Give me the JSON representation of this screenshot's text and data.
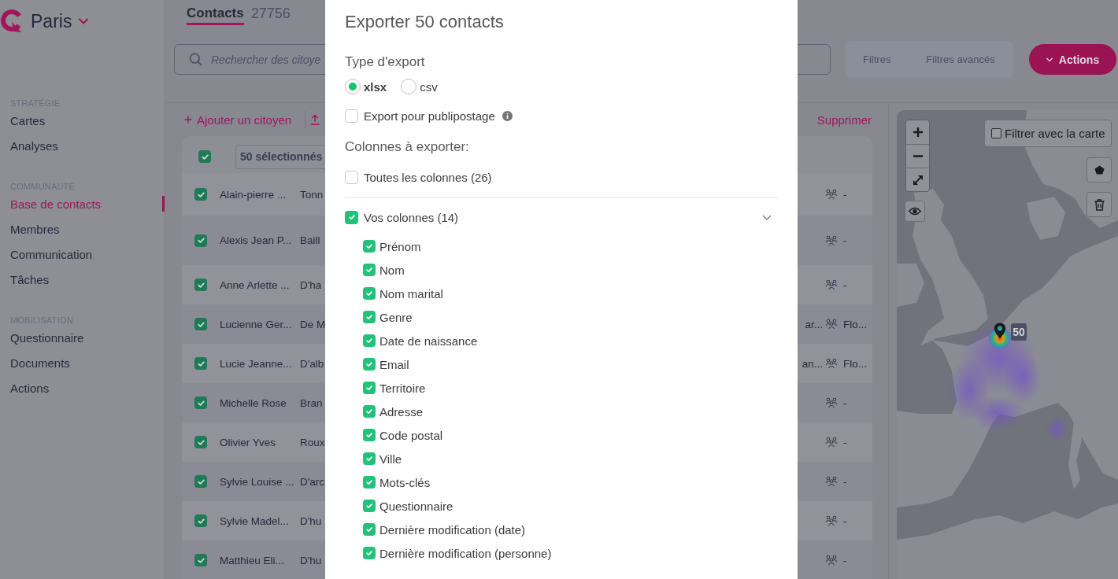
{
  "sidebar": {
    "workspace": "Paris",
    "sections": [
      {
        "heading": "STRATÉGIE",
        "items": [
          {
            "label": "Cartes",
            "selected": false
          },
          {
            "label": "Analyses",
            "selected": false
          }
        ]
      },
      {
        "heading": "COMMUNAUTÉ",
        "items": [
          {
            "label": "Base de contacts",
            "selected": true
          },
          {
            "label": "Membres",
            "selected": false
          },
          {
            "label": "Communication",
            "selected": false
          },
          {
            "label": "Tâches",
            "selected": false
          }
        ]
      },
      {
        "heading": "MOBILISATION",
        "items": [
          {
            "label": "Questionnaire",
            "selected": false
          },
          {
            "label": "Documents",
            "selected": false
          },
          {
            "label": "Actions",
            "selected": false
          }
        ]
      }
    ]
  },
  "tabs": [
    {
      "label": "Contacts",
      "count": "27756",
      "selected": true
    }
  ],
  "search": {
    "placeholder": "Rechercher des citoye"
  },
  "filters": [
    "Filtres",
    "Filtres avancés"
  ],
  "actions_button": {
    "label": "Actions"
  },
  "toolbar": {
    "add_label": "Ajouter un citoyen",
    "delete_label": "Supprimer"
  },
  "table": {
    "select_all": {
      "checked": true
    },
    "selection_label": "50 sélectionnés",
    "rows": [
      {
        "checked": true,
        "column_1": "Alain-pierre ...",
        "column_2": "Tonn",
        "column_4": "-"
      },
      {
        "checked": true,
        "column_1": "Alexis Jean P...",
        "column_2": "Baill",
        "column_4": "-"
      },
      {
        "checked": true,
        "column_1": "Anne Arlette ...",
        "column_2": "D'ha",
        "column_4": "-"
      },
      {
        "checked": true,
        "column_1": "Lucienne Ger...",
        "column_2": "De M",
        "column_3": "ar...",
        "column_4": "Flo..."
      },
      {
        "checked": true,
        "column_1": "Lucie Jeanne...",
        "column_2": "D'alb",
        "column_3": "an...",
        "column_4": "Flo..."
      },
      {
        "checked": true,
        "column_1": "Michelle Rose",
        "column_2": "Bran",
        "column_4": "-"
      },
      {
        "checked": true,
        "column_1": "Olivier Yves",
        "column_2": "Roux",
        "column_4": "-"
      },
      {
        "checked": true,
        "column_1": "Sylvie Louise ...",
        "column_2": "D'arc",
        "column_4": "-"
      },
      {
        "checked": true,
        "column_1": "Sylvie Madel...",
        "column_2": "D'hu",
        "column_4": "-"
      },
      {
        "checked": true,
        "column_1": "Matthieu Eli...",
        "column_2": "D'hu",
        "column_4": "-"
      }
    ]
  },
  "map": {
    "filter": {
      "label": "Filtrer avec la carte",
      "checked": false
    },
    "cluster_count": "50"
  },
  "export_dialog": {
    "title": "Exporter 50 contacts",
    "type_label": "Type d'export",
    "formats": [
      {
        "label": "xlsx",
        "selected": true
      },
      {
        "label": "csv",
        "selected": false
      }
    ],
    "mailing": {
      "label": "Export pour publipostage",
      "checked": false
    },
    "columns_label": "Colonnes à exporter:",
    "all_columns": {
      "label": "Toutes les colonnes (26)",
      "checked": false
    },
    "your_columns": {
      "label": "Vos colonnes (14)",
      "checked": true,
      "expanded": true,
      "children": [
        {
          "label": "Prénom",
          "checked": true
        },
        {
          "label": "Nom",
          "checked": true
        },
        {
          "label": "Nom marital",
          "checked": true
        },
        {
          "label": "Genre",
          "checked": true
        },
        {
          "label": "Date de naissance",
          "checked": true
        },
        {
          "label": "Email",
          "checked": true
        },
        {
          "label": "Territoire",
          "checked": true
        },
        {
          "label": "Adresse",
          "checked": true
        },
        {
          "label": "Code postal",
          "checked": true
        },
        {
          "label": "Ville",
          "checked": true
        },
        {
          "label": "Mots-clés",
          "checked": true
        },
        {
          "label": "Questionnaire",
          "checked": true
        },
        {
          "label": "Dernière modification (date)",
          "checked": true
        },
        {
          "label": "Dernière modification (personne)",
          "checked": true
        }
      ]
    }
  }
}
